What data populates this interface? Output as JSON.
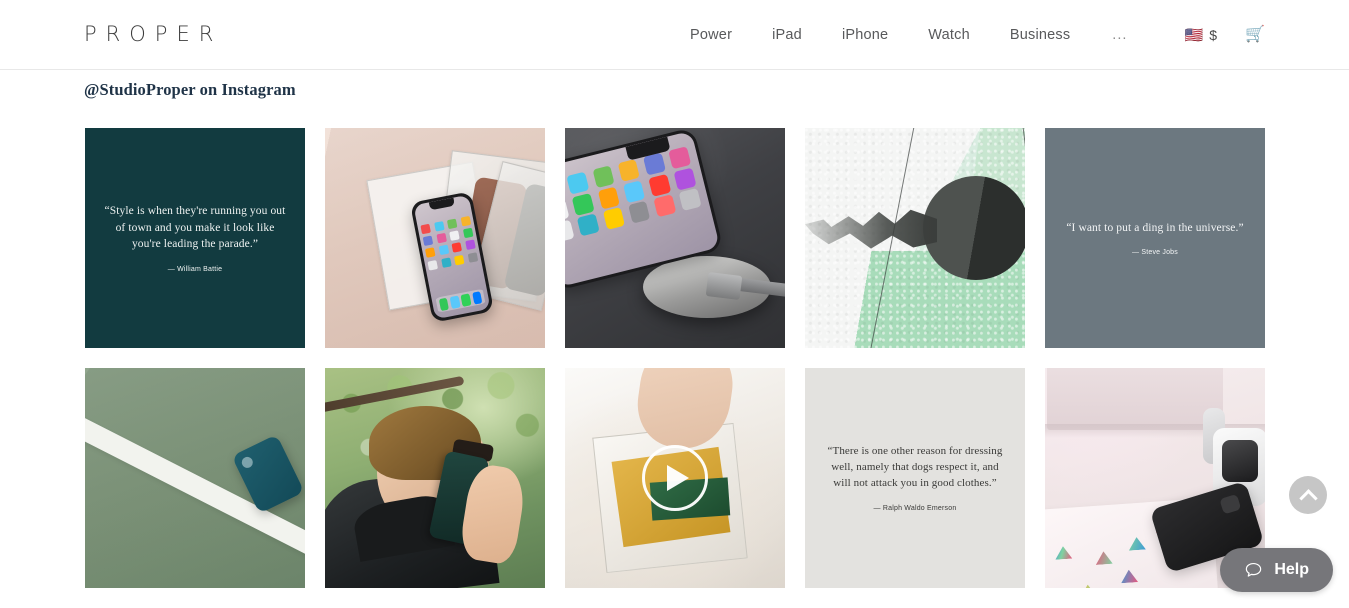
{
  "header": {
    "logo": "PROPER",
    "nav_items": [
      {
        "label": "Power"
      },
      {
        "label": "iPad"
      },
      {
        "label": "iPhone"
      },
      {
        "label": "Watch"
      },
      {
        "label": "Business"
      },
      {
        "label": "..."
      }
    ],
    "currency": {
      "flag": "🇺🇸",
      "symbol": "$"
    },
    "cart": "🛒"
  },
  "feed": {
    "heading": "@StudioProper on Instagram",
    "tiles": [
      {
        "kind": "quote",
        "name": "instagram-tile-quote-battie",
        "background": "#123b40",
        "quote": "“Style is when they're running you out of town and you make it look like you're leading the parade.”",
        "author": "— William Battie"
      },
      {
        "kind": "photo",
        "name": "instagram-tile-photo-cases-on-wood",
        "alt": "iPhone X resting on packaged phone cases on a light wood table"
      },
      {
        "kind": "photo",
        "name": "instagram-tile-photo-wireless-charger",
        "alt": "iPhone X in a black case on a wireless charging pad on a dark desk"
      },
      {
        "kind": "photo",
        "name": "instagram-tile-photo-abstract-texture",
        "alt": "Abstract textured white and mint green surface with a dark circular shape"
      },
      {
        "kind": "quote",
        "name": "instagram-tile-quote-jobs",
        "background": "#6c7880",
        "quote": "“I want to put a ding in the universe.”",
        "author": "— Steve Jobs"
      },
      {
        "kind": "photo",
        "name": "instagram-tile-photo-tennis-court",
        "alt": "Teal phone case lying on a green tennis court beside a white line"
      },
      {
        "kind": "photo",
        "name": "instagram-tile-photo-man-calling",
        "alt": "Man in a black jacket and sunglasses taking a phone call outdoors under trees"
      },
      {
        "kind": "video",
        "name": "instagram-tile-video-pouch",
        "alt": "Video of a hand holding a clear pouch containing yellow and green components"
      },
      {
        "kind": "quote",
        "name": "instagram-tile-quote-emerson",
        "background": "#e3e2df",
        "quote": "“There is one other reason for dressing well, namely that dogs respect it, and will not attack you in good clothes.”",
        "author": "— Ralph Waldo Emerson"
      },
      {
        "kind": "photo",
        "name": "instagram-tile-photo-desk-setup",
        "alt": "Desk with a notebook covered in stickers, a black phone and an Apple Watch on a dock"
      }
    ]
  },
  "controls": {
    "scroll_top_label": "Back to top",
    "help_label": "Help"
  }
}
